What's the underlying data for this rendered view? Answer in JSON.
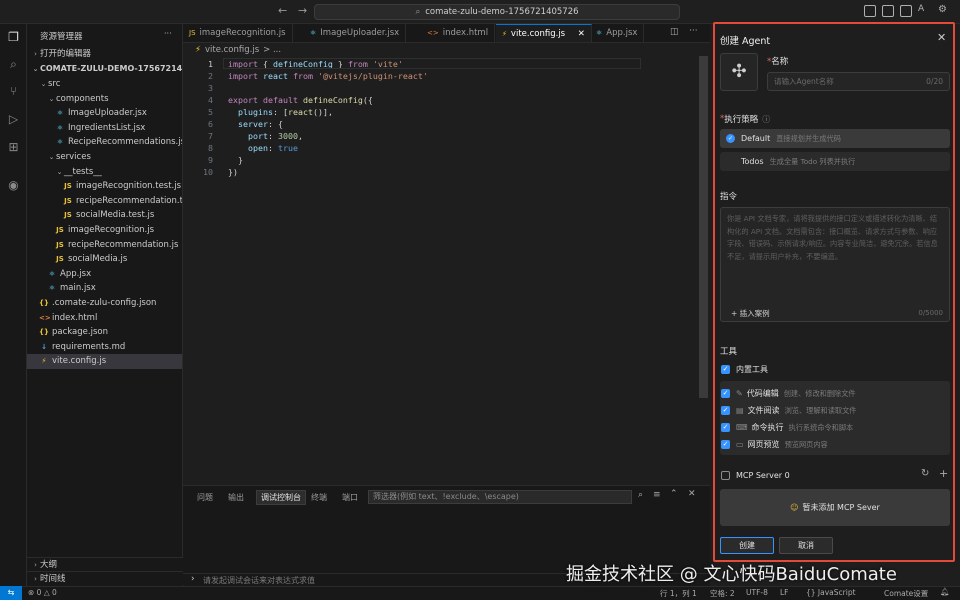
{
  "titlebar": {
    "search_text": "comate-zulu-demo-1756721405726",
    "back_glyph": "←",
    "forward_glyph": "→"
  },
  "sidebar": {
    "title": "资源管理器",
    "more_glyph": "···",
    "open_editors": "打开的编辑器",
    "project": "COMATE-ZULU-DEMO-17567214057...",
    "tree": [
      {
        "label": "src",
        "icon": "folder-chevron",
        "type": "folder",
        "depth": 1
      },
      {
        "label": "components",
        "icon": "folder-chevron",
        "type": "folder",
        "depth": 2
      },
      {
        "label": "ImageUploader.jsx",
        "icon": "react-icon",
        "type": "jsx",
        "depth": 3
      },
      {
        "label": "IngredientsList.jsx",
        "icon": "react-icon",
        "type": "jsx",
        "depth": 3
      },
      {
        "label": "RecipeRecommendations.jsx",
        "icon": "react-icon",
        "type": "jsx",
        "depth": 3
      },
      {
        "label": "services",
        "icon": "folder-chevron",
        "type": "folder",
        "depth": 2
      },
      {
        "label": "__tests__",
        "icon": "folder-chevron",
        "type": "folder",
        "depth": 3
      },
      {
        "label": "imageRecognition.test.js",
        "icon": "js-icon",
        "type": "js",
        "depth": 4
      },
      {
        "label": "recipeRecommendation.te...",
        "icon": "js-icon",
        "type": "js",
        "depth": 4
      },
      {
        "label": "socialMedia.test.js",
        "icon": "js-icon",
        "type": "js",
        "depth": 4
      },
      {
        "label": "imageRecognition.js",
        "icon": "js-icon",
        "type": "js",
        "depth": 3
      },
      {
        "label": "recipeRecommendation.js",
        "icon": "js-icon",
        "type": "js",
        "depth": 3
      },
      {
        "label": "socialMedia.js",
        "icon": "js-icon",
        "type": "js",
        "depth": 3
      },
      {
        "label": "App.jsx",
        "icon": "react-icon",
        "type": "jsx",
        "depth": 2
      },
      {
        "label": "main.jsx",
        "icon": "react-icon",
        "type": "jsx",
        "depth": 2
      },
      {
        "label": ".comate-zulu-config.json",
        "icon": "json-icon",
        "type": "json",
        "depth": 1
      },
      {
        "label": "index.html",
        "icon": "html-icon",
        "type": "html",
        "depth": 1
      },
      {
        "label": "package.json",
        "icon": "json-icon",
        "type": "json",
        "depth": 1
      },
      {
        "label": "requirements.md",
        "icon": "markdown-icon",
        "type": "md",
        "depth": 1
      },
      {
        "label": "vite.config.js",
        "icon": "vite-icon",
        "type": "vite",
        "depth": 1,
        "selected": true
      }
    ],
    "outline": "大纲",
    "timeline": "时间线"
  },
  "tabs": [
    {
      "label": "imageRecognition.js",
      "prefix": "JS"
    },
    {
      "label": "ImageUploader.jsx",
      "prefix": "⚛"
    },
    {
      "label": "index.html",
      "prefix": "<>"
    },
    {
      "label": "vite.config.js",
      "prefix": "⚡",
      "active": true
    },
    {
      "label": "App.jsx",
      "prefix": "⚛"
    }
  ],
  "breadcrumb": {
    "file": "vite.config.js",
    "sep": "> ..."
  },
  "editor": {
    "line_numbers": [
      "1",
      "2",
      "3",
      "4",
      "5",
      "6",
      "7",
      "8",
      "9",
      "10"
    ]
  },
  "panel": {
    "tabs": [
      "问题",
      "输出",
      "调试控制台",
      "终端",
      "端口"
    ],
    "active_tab": "调试控制台",
    "filter_placeholder": "筛选器(例如 text、!exclude、\\escape)",
    "input_placeholder": "请发起调试会话来对表达式求值"
  },
  "statusbar": {
    "errors": "⊗ 0 △ 0",
    "position": "行 1，列 1",
    "spaces": "空格: 2",
    "encoding": "UTF-8",
    "eol": "LF",
    "language": "{} JavaScript",
    "comate": "Comate设置"
  },
  "agent": {
    "title": "创建 Agent",
    "name_label": "名称",
    "name_placeholder": "请输入Agent名称",
    "name_count": "0/20",
    "strategy_label": "执行策略",
    "strategies": [
      {
        "name": "Default",
        "desc": "直接规划并生成代码",
        "selected": true
      },
      {
        "name": "Todos",
        "desc": "生成全量 Todo 列表并执行",
        "selected": false
      }
    ],
    "instructions_label": "指令",
    "instructions_placeholder": "你是 API 文档专家，请将我提供的接口定义或描述转化为清晰、结构化的 API 文档。文档需包含：接口概览、请求方式与参数、响应字段、错误码、示例请求/响应。内容专业简洁，避免冗余。若信息不足，请提示用户补充，不要编造。",
    "insert_example": "+ 插入案例",
    "instructions_count": "0/5000",
    "tools_label": "工具",
    "builtin_tools": "内置工具",
    "tools": [
      {
        "name": "代码编辑",
        "desc": "创建、修改和删除文件",
        "icon": "pencil-icon"
      },
      {
        "name": "文件阅读",
        "desc": "浏览、理解和读取文件",
        "icon": "file-icon"
      },
      {
        "name": "命令执行",
        "desc": "执行系统命令和脚本",
        "icon": "terminal-icon"
      },
      {
        "name": "网页预览",
        "desc": "预览网页内容",
        "icon": "browser-icon"
      }
    ],
    "mcp_label": "MCP Server 0",
    "mcp_empty": "暂未添加 MCP Sever",
    "create_label": "创建",
    "cancel_label": "取消"
  },
  "watermark": "掘金技术社区 @ 文心快码BaiduComate"
}
